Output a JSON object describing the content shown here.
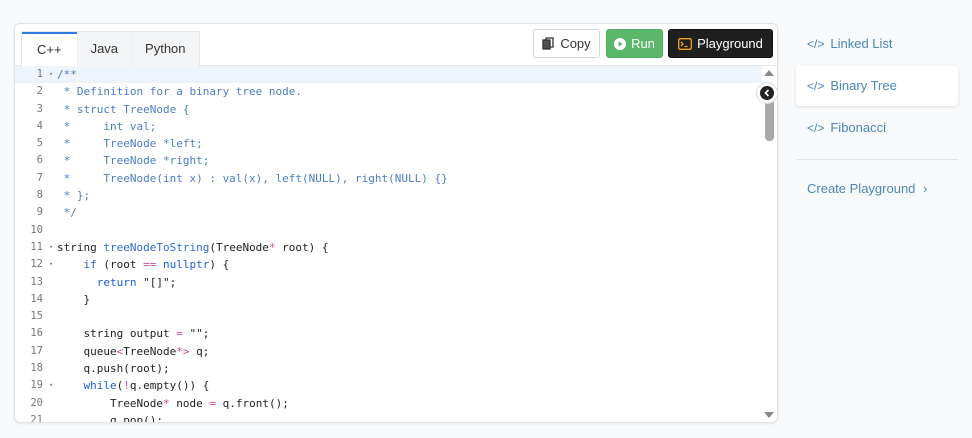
{
  "tabs": [
    {
      "label": "C++",
      "active": true
    },
    {
      "label": "Java",
      "active": false
    },
    {
      "label": "Python",
      "active": false
    }
  ],
  "toolbar": {
    "copy_label": "Copy",
    "run_label": "Run",
    "playground_label": "Playground",
    "copy_icon": "copy-icon",
    "run_icon": "play-circle-icon",
    "playground_icon": "terminal-icon"
  },
  "code_lines": [
    {
      "n": "1",
      "fold": true,
      "hl": true,
      "text": "/**"
    },
    {
      "n": "2",
      "fold": false,
      "text": " * Definition for a binary tree node."
    },
    {
      "n": "3",
      "fold": false,
      "text": " * struct TreeNode {"
    },
    {
      "n": "4",
      "fold": false,
      "text": " *     int val;"
    },
    {
      "n": "5",
      "fold": false,
      "text": " *     TreeNode *left;"
    },
    {
      "n": "6",
      "fold": false,
      "text": " *     TreeNode *right;"
    },
    {
      "n": "7",
      "fold": false,
      "text": " *     TreeNode(int x) : val(x), left(NULL), right(NULL) {}"
    },
    {
      "n": "8",
      "fold": false,
      "text": " * };"
    },
    {
      "n": "9",
      "fold": false,
      "text": " */"
    },
    {
      "n": "10",
      "fold": false,
      "text": ""
    },
    {
      "n": "11",
      "fold": true,
      "text": "string treeNodeToString(TreeNode* root) {"
    },
    {
      "n": "12",
      "fold": true,
      "text": "    if (root == nullptr) {"
    },
    {
      "n": "13",
      "fold": false,
      "text": "      return \"[]\";"
    },
    {
      "n": "14",
      "fold": false,
      "text": "    }"
    },
    {
      "n": "15",
      "fold": false,
      "text": ""
    },
    {
      "n": "16",
      "fold": false,
      "text": "    string output = \"\";"
    },
    {
      "n": "17",
      "fold": false,
      "text": "    queue<TreeNode*> q;"
    },
    {
      "n": "18",
      "fold": false,
      "text": "    q.push(root);"
    },
    {
      "n": "19",
      "fold": true,
      "text": "    while(!q.empty()) {"
    },
    {
      "n": "20",
      "fold": false,
      "text": "        TreeNode* node = q.front();"
    },
    {
      "n": "21",
      "fold": false,
      "text": "        q.pop();"
    }
  ],
  "sidebar": {
    "items": [
      {
        "label": "Linked List",
        "icon": "code-icon",
        "active": false
      },
      {
        "label": "Binary Tree",
        "icon": "code-icon",
        "active": true
      },
      {
        "label": "Fibonacci",
        "icon": "code-icon",
        "active": false
      }
    ],
    "create_label": "Create Playground",
    "create_chevron": "›"
  },
  "colors": {
    "accent": "#2c7be5",
    "run_green": "#5bb86a",
    "playground_dark": "#1f1f1f",
    "comment_blue": "#4a7ec4",
    "link_blue": "#4a87b8"
  }
}
